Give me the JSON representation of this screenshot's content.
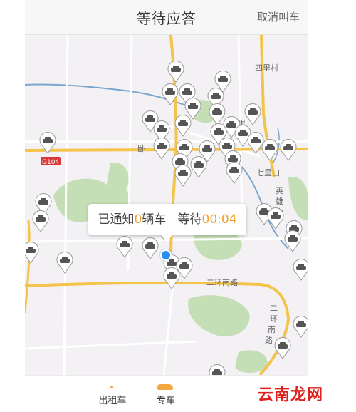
{
  "header": {
    "title": "等待应答",
    "cancel_label": "取消叫车"
  },
  "bubble": {
    "prefix": "已通知",
    "count": "0",
    "unit": "辆车",
    "wait_label": "等待",
    "timer": "00:04"
  },
  "tabs": [
    {
      "label": "出租车"
    },
    {
      "label": "专车"
    }
  ],
  "map": {
    "labels": {
      "sililcun": "四里村",
      "qililu": "七里",
      "qilishan": "七里山",
      "wo": "卧",
      "g104": "G104",
      "yingxiong": "英",
      "xiong": "雄",
      "shan": "山",
      "erhuan": "二环南路",
      "erhuan2": "二",
      "huan": "环",
      "nan": "南",
      "lu": "路"
    },
    "colors": {
      "road_major": "#f3c34a",
      "road_white": "#ffffff",
      "green": "#c4dfb6",
      "water": "#7aa6cf",
      "bg": "#f3f1f4",
      "accent": "#f39c26",
      "location": "#2b8ef0"
    }
  },
  "watermark": "云南龙网"
}
